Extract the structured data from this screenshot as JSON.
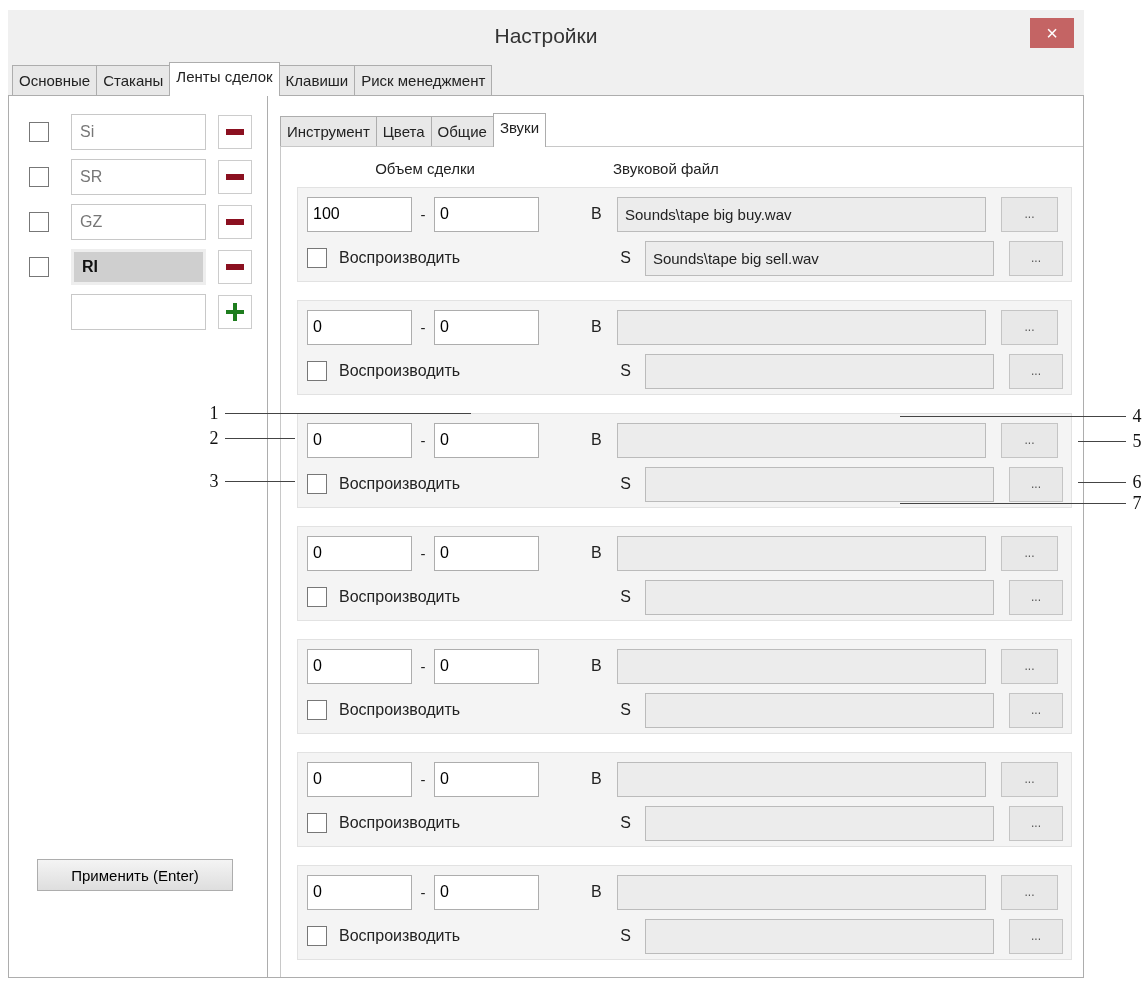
{
  "window": {
    "title": "Настройки",
    "close": "×"
  },
  "tabs": [
    {
      "label": "Основные",
      "selected": false
    },
    {
      "label": "Стаканы",
      "selected": false
    },
    {
      "label": "Ленты сделок",
      "selected": true
    },
    {
      "label": "Клавиши",
      "selected": false
    },
    {
      "label": "Риск менеджмент",
      "selected": false
    }
  ],
  "instruments": [
    {
      "symbol": "Si",
      "checked": false,
      "selected": false
    },
    {
      "symbol": "SR",
      "checked": false,
      "selected": false
    },
    {
      "symbol": "GZ",
      "checked": false,
      "selected": false
    },
    {
      "symbol": "RI",
      "checked": false,
      "selected": true
    }
  ],
  "apply_button": "Применить (Enter)",
  "subtabs": [
    {
      "label": "Инструмент",
      "selected": false
    },
    {
      "label": "Цвета",
      "selected": false
    },
    {
      "label": "Общие",
      "selected": false
    },
    {
      "label": "Звуки",
      "selected": true
    }
  ],
  "columns": {
    "volume": "Объем сделки",
    "file": "Звуковой файл"
  },
  "sound_rules": [
    {
      "from": "100",
      "separator": "-",
      "to": "0",
      "play_label": "Воспроизводить",
      "play_checked": false,
      "buy_label": "B",
      "buy_file": "Sounds\\tape big buy.wav",
      "sell_label": "S",
      "sell_file": "Sounds\\tape big sell.wav",
      "browse_buy": "...",
      "browse_sell": "..."
    },
    {
      "from": "0",
      "separator": "-",
      "to": "0",
      "play_label": "Воспроизводить",
      "play_checked": false,
      "buy_label": "B",
      "sell_label": "S",
      "browse_buy": "...",
      "browse_sell": "..."
    },
    {
      "from": "0",
      "separator": "-",
      "to": "0",
      "play_label": "Воспроизводить",
      "play_checked": false,
      "buy_label": "B",
      "sell_label": "S",
      "browse_buy": "...",
      "browse_sell": "...",
      "callouts": [
        "1",
        "2",
        "3",
        "4",
        "5",
        "6",
        "7"
      ]
    },
    {
      "from": "0",
      "separator": "-",
      "to": "0",
      "play_label": "Воспроизводить",
      "play_checked": false,
      "buy_label": "B",
      "sell_label": "S",
      "browse_buy": "...",
      "browse_sell": "..."
    },
    {
      "from": "0",
      "separator": "-",
      "to": "0",
      "play_label": "Воспроизводить",
      "play_checked": false,
      "buy_label": "B",
      "sell_label": "S",
      "browse_buy": "...",
      "browse_sell": "..."
    },
    {
      "from": "0",
      "separator": "-",
      "to": "0",
      "play_label": "Воспроизводить",
      "play_checked": false,
      "buy_label": "B",
      "sell_label": "S",
      "browse_buy": "...",
      "browse_sell": "..."
    },
    {
      "from": "0",
      "separator": "-",
      "to": "0",
      "play_label": "Воспроизводить",
      "play_checked": false,
      "buy_label": "B",
      "sell_label": "S",
      "browse_buy": "...",
      "browse_sell": "..."
    }
  ]
}
